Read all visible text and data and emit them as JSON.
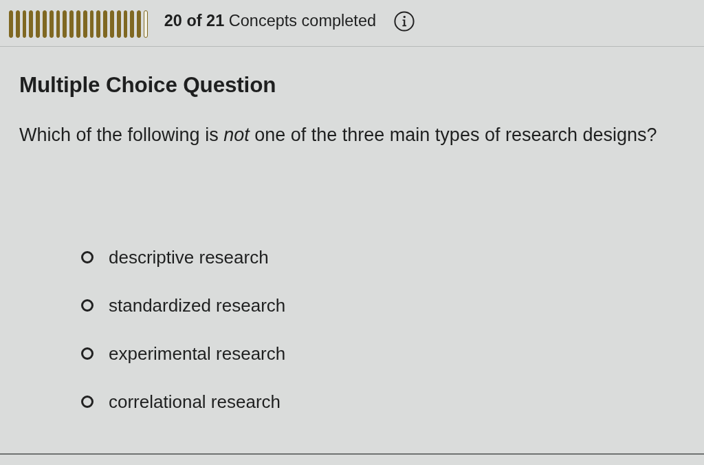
{
  "progress": {
    "segments": [
      {
        "filled": true
      },
      {
        "filled": true
      },
      {
        "filled": true
      },
      {
        "filled": true
      },
      {
        "filled": true
      },
      {
        "filled": true
      },
      {
        "filled": true
      },
      {
        "filled": true
      },
      {
        "filled": true
      },
      {
        "filled": true
      },
      {
        "filled": true
      },
      {
        "filled": true
      },
      {
        "filled": true
      },
      {
        "filled": true
      },
      {
        "filled": true
      },
      {
        "filled": true
      },
      {
        "filled": true
      },
      {
        "filled": true
      },
      {
        "filled": true
      },
      {
        "filled": true
      },
      {
        "filled": false
      }
    ],
    "summary": "**20 of 21** Concepts completed"
  },
  "question": {
    "type_label": "Multiple Choice Question",
    "prompt": "Which of the following is *not* one of the three main types of research designs?"
  },
  "options": [
    {
      "label": "descriptive research",
      "selected": false
    },
    {
      "label": "standardized research",
      "selected": false
    },
    {
      "label": "experimental research",
      "selected": false
    },
    {
      "label": "correlational research",
      "selected": false
    }
  ]
}
